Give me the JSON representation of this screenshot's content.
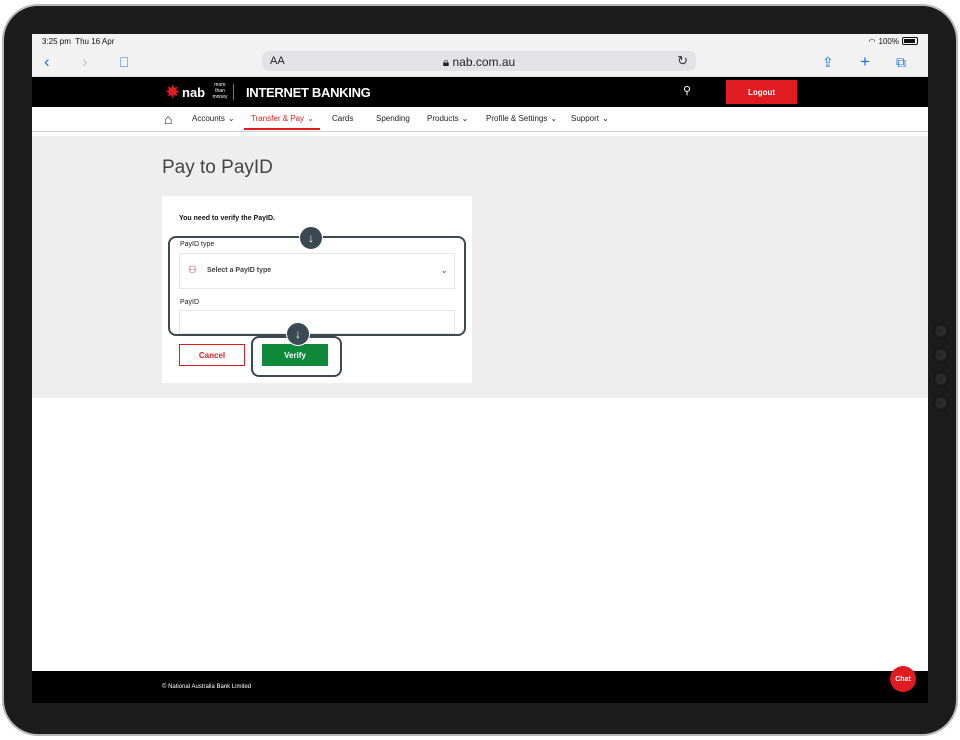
{
  "status_bar": {
    "time": "3:25 pm",
    "date": "Thu 16 Apr",
    "battery": "100%",
    "wifi_icon": "wifi-icon"
  },
  "browser": {
    "text_size": "AA",
    "url": "nab.com.au"
  },
  "header": {
    "brand": "nab",
    "tagline": [
      "more",
      "than",
      "money"
    ],
    "title": "INTERNET BANKING",
    "logout_label": "Logout"
  },
  "nav": {
    "items": [
      {
        "label": "Accounts",
        "has_menu": true
      },
      {
        "label": "Transfer & Pay",
        "has_menu": true,
        "active": true
      },
      {
        "label": "Cards",
        "has_menu": false
      },
      {
        "label": "Spending",
        "has_menu": false
      },
      {
        "label": "Products",
        "has_menu": true
      },
      {
        "label": "Profile & Settings",
        "has_menu": true
      },
      {
        "label": "Support",
        "has_menu": true
      }
    ]
  },
  "page": {
    "title": "Pay to PayID",
    "notice": "You need to verify the PayID.",
    "payid_type_label": "PayID type",
    "payid_type_placeholder": "Select a PayID type",
    "payid_label": "PayID",
    "payid_value": "",
    "cancel_label": "Cancel",
    "verify_label": "Verify"
  },
  "footer": {
    "copyright": "© National Australia Bank Limited",
    "chat_label": "Chat"
  },
  "colors": {
    "brand_red": "#e11b22",
    "verify_green": "#0e8a3a",
    "highlight": "#3b4a52"
  }
}
